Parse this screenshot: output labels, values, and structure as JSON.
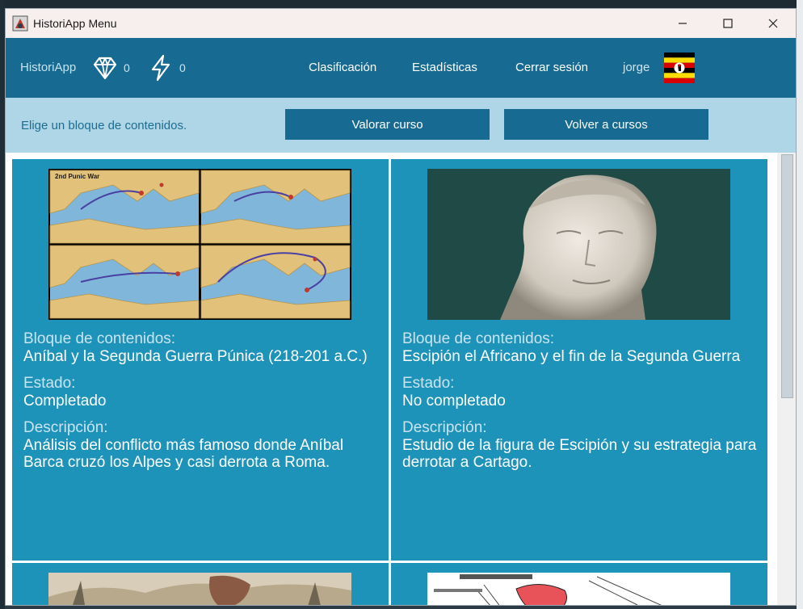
{
  "window": {
    "title": "HistoriApp Menu"
  },
  "navbar": {
    "brand": "HistoriApp",
    "gems": "0",
    "energy": "0",
    "links": [
      "Clasificación",
      "Estadísticas",
      "Cerrar sesión"
    ],
    "user": "jorge"
  },
  "subbar": {
    "hint": "Elige un bloque de contenidos.",
    "rate_button": "Valorar curso",
    "back_button": "Volver a cursos"
  },
  "cards": [
    {
      "block_label": "Bloque de contenidos:",
      "block_title": "Aníbal y la Segunda Guerra Púnica (218-201 a.C.)",
      "status_label": "Estado:",
      "status": "Completado",
      "desc_label": "Descripción:",
      "description": "Análisis del conflicto más famoso donde Aníbal Barca cruzó los Alpes y casi derrota a Roma.",
      "image_title": "2nd Punic War"
    },
    {
      "block_label": "Bloque de contenidos:",
      "block_title": "Escipión el Africano y el fin de la Segunda Guerra",
      "status_label": "Estado:",
      "status": "No completado",
      "desc_label": "Descripción:",
      "description": "Estudio de la figura de Escipión y su estrategia para derrotar a Cartago."
    }
  ],
  "colors": {
    "navbar": "#176a91",
    "subbar": "#afd6e6",
    "card": "#1e93b9",
    "button": "#176a91"
  },
  "icons": {
    "app": "app-icon",
    "gem": "diamond-icon",
    "energy": "lightning-icon",
    "flag": "flag-icon"
  }
}
